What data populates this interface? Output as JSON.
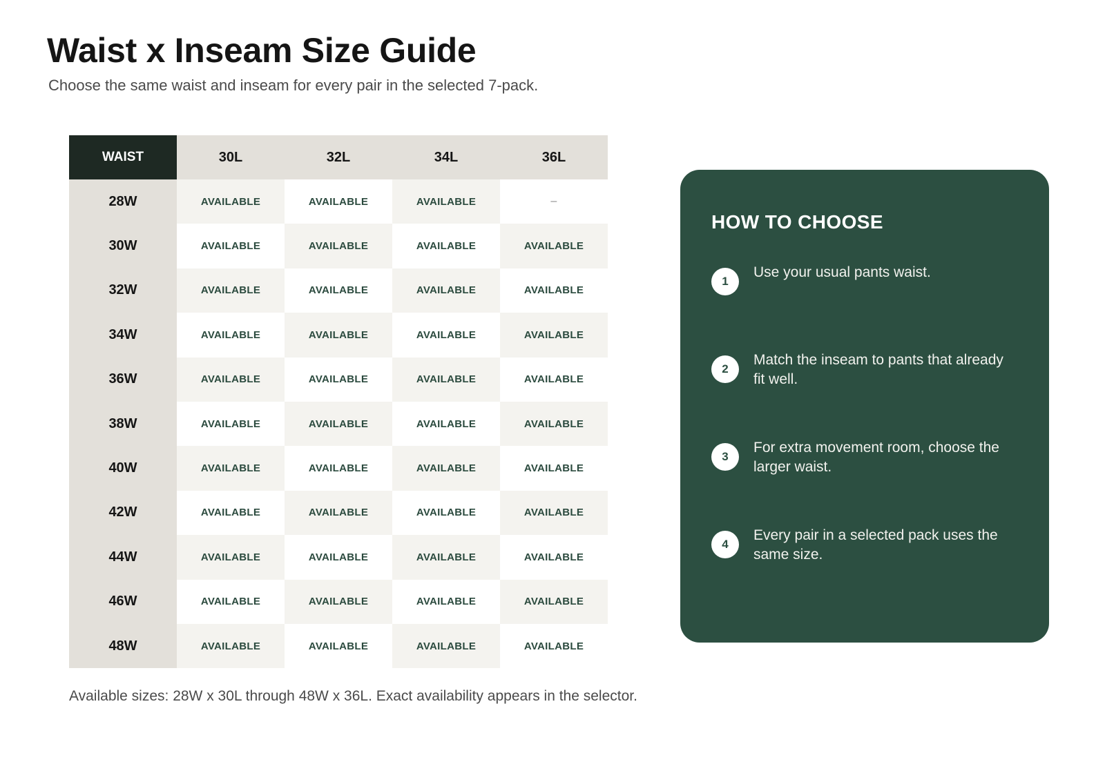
{
  "page": {
    "title": "Waist x Inseam Size Guide",
    "subtitle": "Choose the same waist and inseam for every pair in the selected 7-pack.",
    "note": "Available sizes: 28W x 30L through 48W x 36L. Exact availability appears in the selector."
  },
  "grid": {
    "corner_label": "WAIST",
    "columns": [
      "30L",
      "32L",
      "34L",
      "36L"
    ],
    "rows": [
      {
        "waist": "28W",
        "cells": [
          "AVAILABLE",
          "AVAILABLE",
          "AVAILABLE",
          "–"
        ]
      },
      {
        "waist": "30W",
        "cells": [
          "AVAILABLE",
          "AVAILABLE",
          "AVAILABLE",
          "AVAILABLE"
        ]
      },
      {
        "waist": "32W",
        "cells": [
          "AVAILABLE",
          "AVAILABLE",
          "AVAILABLE",
          "AVAILABLE"
        ]
      },
      {
        "waist": "34W",
        "cells": [
          "AVAILABLE",
          "AVAILABLE",
          "AVAILABLE",
          "AVAILABLE"
        ]
      },
      {
        "waist": "36W",
        "cells": [
          "AVAILABLE",
          "AVAILABLE",
          "AVAILABLE",
          "AVAILABLE"
        ]
      },
      {
        "waist": "38W",
        "cells": [
          "AVAILABLE",
          "AVAILABLE",
          "AVAILABLE",
          "AVAILABLE"
        ]
      },
      {
        "waist": "40W",
        "cells": [
          "AVAILABLE",
          "AVAILABLE",
          "AVAILABLE",
          "AVAILABLE"
        ]
      },
      {
        "waist": "42W",
        "cells": [
          "AVAILABLE",
          "AVAILABLE",
          "AVAILABLE",
          "AVAILABLE"
        ]
      },
      {
        "waist": "44W",
        "cells": [
          "AVAILABLE",
          "AVAILABLE",
          "AVAILABLE",
          "AVAILABLE"
        ]
      },
      {
        "waist": "46W",
        "cells": [
          "AVAILABLE",
          "AVAILABLE",
          "AVAILABLE",
          "AVAILABLE"
        ]
      },
      {
        "waist": "48W",
        "cells": [
          "AVAILABLE",
          "AVAILABLE",
          "AVAILABLE",
          "AVAILABLE"
        ]
      }
    ]
  },
  "guide": {
    "title": "HOW TO CHOOSE",
    "steps": [
      {
        "num": "1",
        "text": "Use your usual pants waist."
      },
      {
        "num": "2",
        "text": "Match the inseam to pants that already fit well."
      },
      {
        "num": "3",
        "text": "For extra movement room, choose the larger waist."
      },
      {
        "num": "4",
        "text": "Every pair in a selected pack uses the same size."
      }
    ]
  },
  "colors": {
    "panel": "#2c4f41",
    "header_dark": "#1e2923",
    "header_light": "#e3e0da",
    "available_text": "#2b4a3e"
  }
}
